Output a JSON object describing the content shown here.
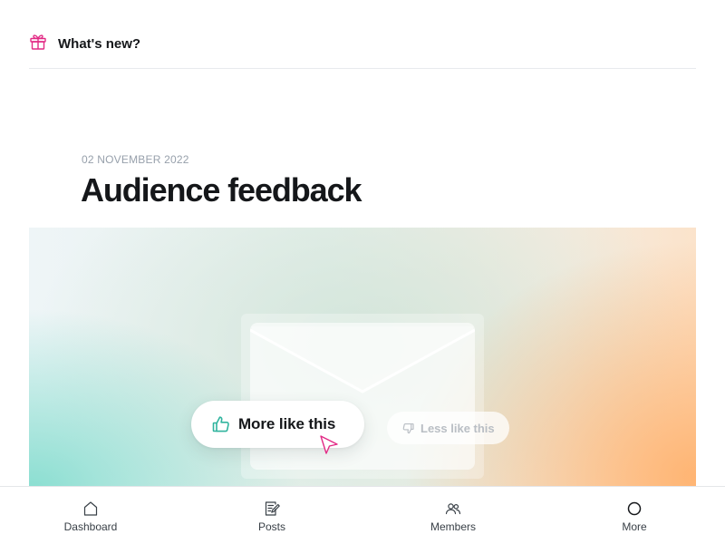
{
  "header": {
    "title": "What's new?",
    "icon": "gift-icon",
    "icon_color": "#e22a85"
  },
  "post": {
    "date": "02 NOVEMBER 2022",
    "title": "Audience feedback"
  },
  "feature_image": {
    "more_label": "More like this",
    "more_icon": "thumbs-up-icon",
    "less_label": "Less like this",
    "less_icon": "thumbs-down-icon",
    "accent_color": "#30b49e",
    "cursor_color": "#e22a85"
  },
  "bottom_nav": {
    "items": [
      {
        "label": "Dashboard",
        "icon": "home-icon"
      },
      {
        "label": "Posts",
        "icon": "posts-icon"
      },
      {
        "label": "Members",
        "icon": "members-icon"
      },
      {
        "label": "More",
        "icon": "circle-icon"
      }
    ]
  }
}
